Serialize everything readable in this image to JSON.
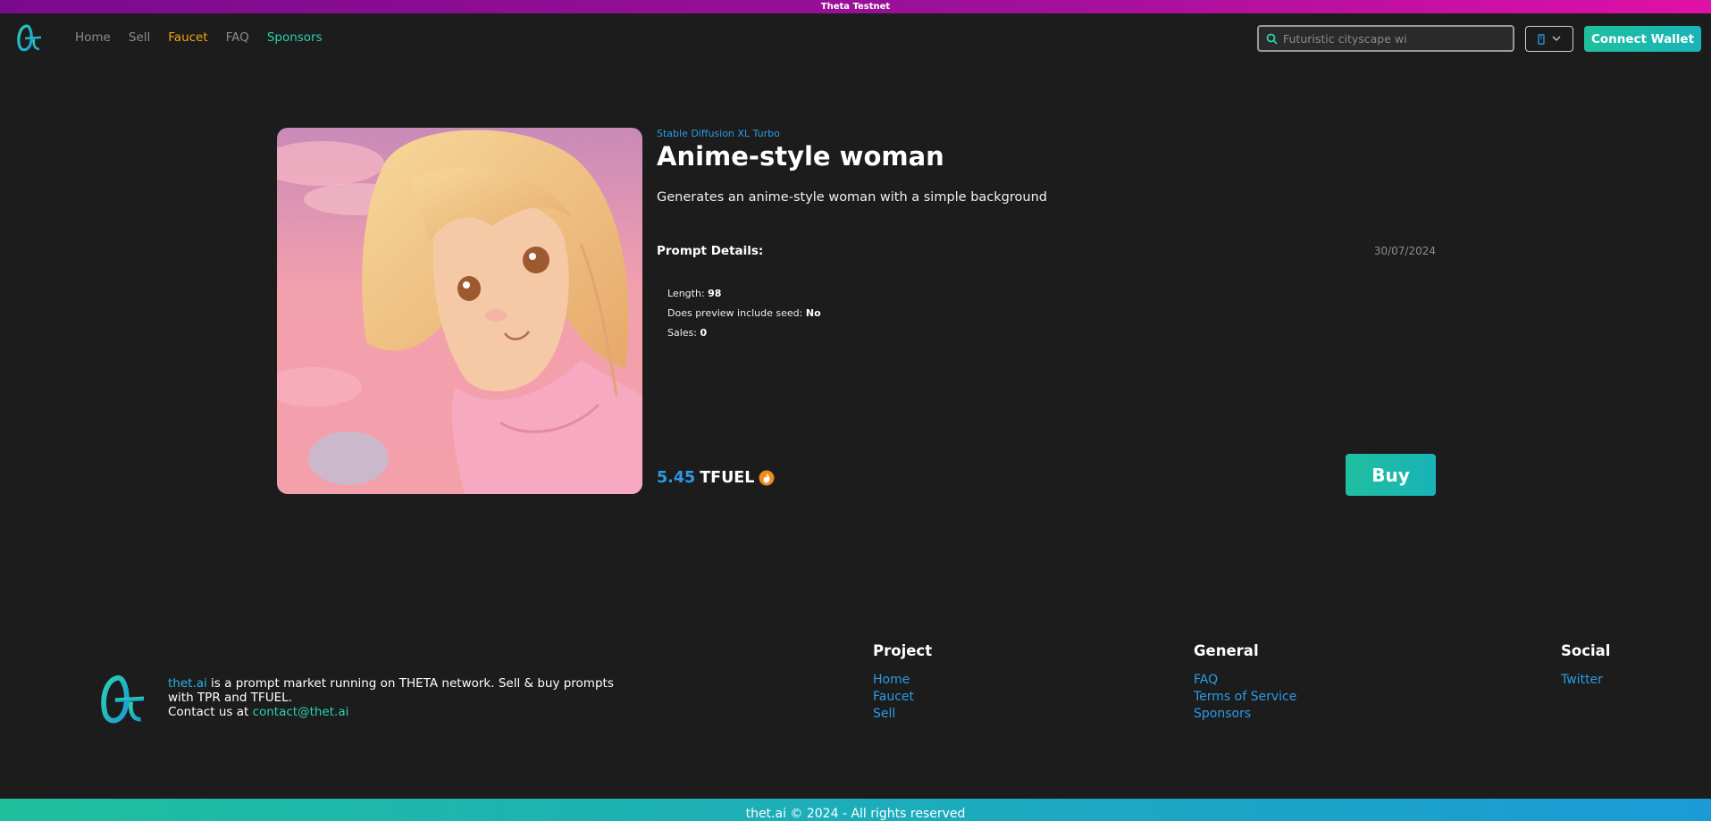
{
  "banner": {
    "text": "Theta Testnet"
  },
  "nav": {
    "links": {
      "home": "Home",
      "sell": "Sell",
      "faucet": "Faucet",
      "faq": "FAQ",
      "sponsors": "Sponsors"
    },
    "search": {
      "placeholder": "Futuristic cityscape wi"
    },
    "connect_label": "Connect Wallet"
  },
  "prompt": {
    "model": "Stable Diffusion XL Turbo",
    "title": "Anime-style woman",
    "description": "Generates an anime-style woman with a simple background",
    "details_label": "Prompt Details:",
    "date": "30/07/2024",
    "details": [
      {
        "label": "Length:",
        "value": "98"
      },
      {
        "label": "Does preview include seed:",
        "value": "No"
      },
      {
        "label": "Sales:",
        "value": "0"
      }
    ],
    "price": "5.45",
    "currency": "TFUEL",
    "buy_label": "Buy"
  },
  "footer": {
    "brand": "thet.ai",
    "description": " is a prompt market running on THETA network. Sell & buy prompts with TPR and TFUEL.",
    "contact_prefix": "Contact us at ",
    "contact_email": "contact@thet.ai",
    "columns": {
      "project": {
        "title": "Project",
        "links": [
          "Home",
          "Faucet",
          "Sell"
        ]
      },
      "general": {
        "title": "General",
        "links": [
          "FAQ",
          "Terms of Service",
          "Sponsors"
        ]
      },
      "social": {
        "title": "Social",
        "links": [
          "Twitter"
        ]
      }
    },
    "copyright": "thet.ai © 2024 - All rights reserved"
  },
  "colors": {
    "accent": "#2ad1b0",
    "link": "#2b9be6",
    "faucet": "#f7a20b",
    "background": "#1c1c1c"
  }
}
